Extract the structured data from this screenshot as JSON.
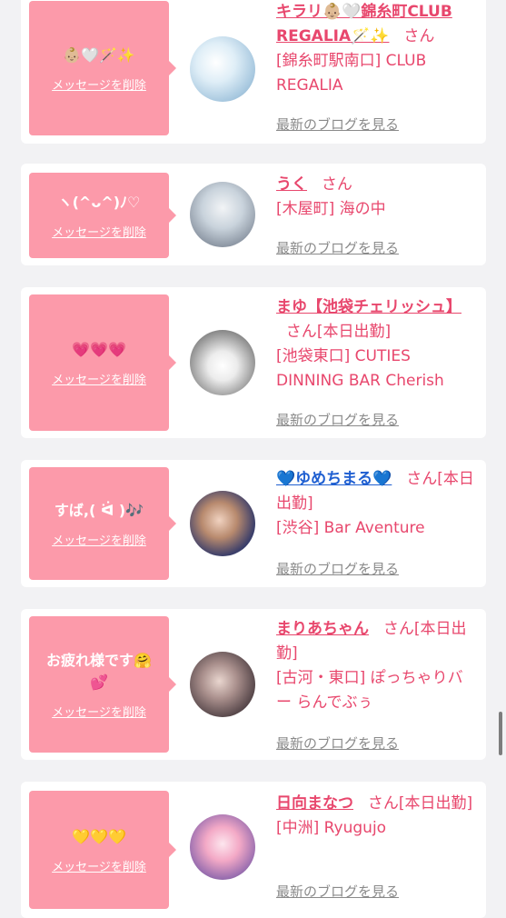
{
  "delete_label": "メッセージを削除",
  "blog_label": "最新のブログを見る",
  "san_suffix": "さん",
  "accent_color": "#fc9aaa",
  "text_color": "#e8476d",
  "items": [
    {
      "message": "👶🏼🤍🪄✨",
      "name": "キラリ👶🏼🤍錦糸町CLUB REGALIA🪄✨",
      "status": "",
      "shop": "[錦糸町駅南口] CLUB REGALIA"
    },
    {
      "message": "ヽ(^ᴗ^)ﾉ♡",
      "name": "うく",
      "status": "",
      "shop": "[木屋町] 海の中"
    },
    {
      "message": "💗💗💗",
      "name": "まゆ【池袋チェリッシュ】",
      "status": "[本日出勤]",
      "shop": "[池袋東口] CUTIES DINNING BAR Cherish"
    },
    {
      "message": "すば,( ᐛ )🎶",
      "name": "💙ゆめちまる💙",
      "status": "[本日出勤]",
      "shop": "[渋谷] Bar Aventure"
    },
    {
      "message": "お疲れ様です🤗💕",
      "name": "まりあちゃん",
      "status": "[本日出勤]",
      "shop": "[古河・東口] ぽっちゃりバー らんでぶぅ"
    },
    {
      "message": "💛💛💛",
      "name": "日向まなつ",
      "status": "[本日出勤]",
      "shop": "[中洲] Ryugujo"
    }
  ]
}
